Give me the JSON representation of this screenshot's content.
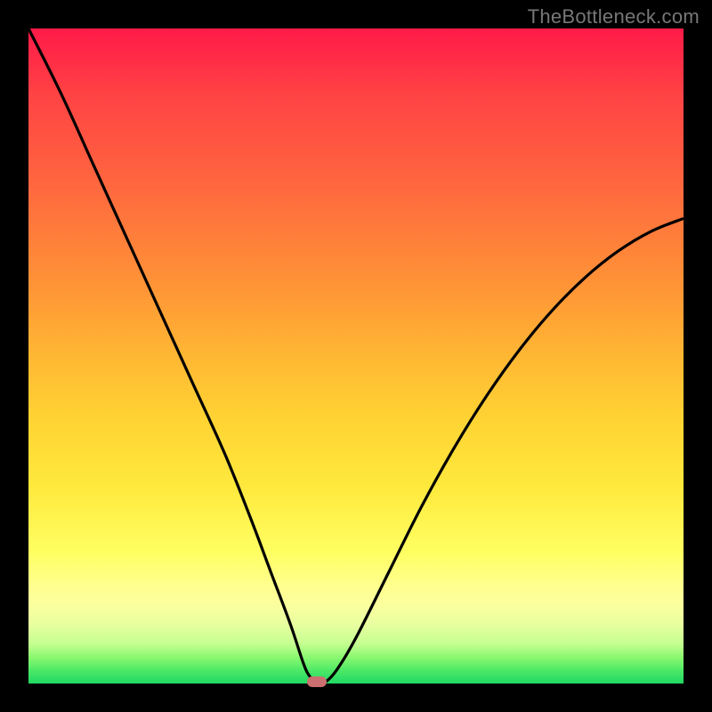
{
  "watermark": "TheBottleneck.com",
  "colors": {
    "frame": "#000000",
    "curve": "#000000",
    "marker": "#cc6f70",
    "gradient_top": "#ff1a48",
    "gradient_bottom": "#1fd864"
  },
  "chart_data": {
    "type": "line",
    "title": "",
    "xlabel": "",
    "ylabel": "",
    "xlim": [
      0,
      100
    ],
    "ylim": [
      0,
      100
    ],
    "grid": false,
    "series": [
      {
        "name": "bottleneck-curve",
        "x": [
          0,
          5,
          10,
          15,
          20,
          25,
          30,
          34,
          37,
          40,
          42,
          43,
          44,
          45,
          47,
          50,
          55,
          60,
          65,
          70,
          75,
          80,
          85,
          90,
          95,
          100
        ],
        "values": [
          100,
          90,
          79,
          68,
          57,
          46,
          35,
          25,
          17,
          9,
          3,
          1,
          0,
          0,
          2,
          7,
          17,
          27,
          36,
          44,
          51,
          57,
          62,
          66,
          69,
          71
        ]
      }
    ],
    "annotations": [
      {
        "name": "min-marker",
        "x": 44,
        "y": 0
      }
    ]
  }
}
